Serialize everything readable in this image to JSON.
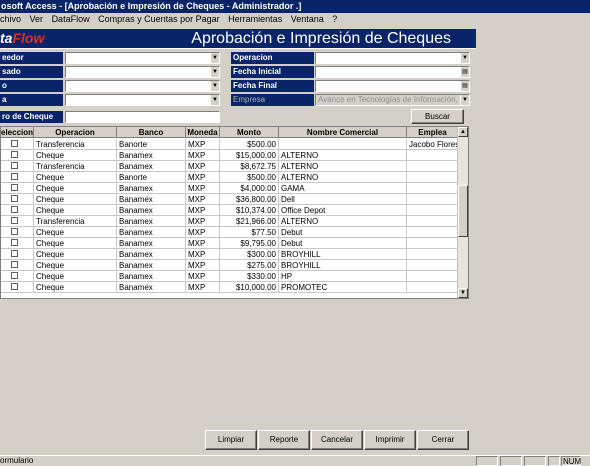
{
  "window": {
    "title": "osoft Access - [Aprobación e Impresión de Cheques - Administrador .]"
  },
  "menu": [
    "chivo",
    "Ver",
    "DataFlow",
    "Compras y Cuentas por Pagar",
    "Herramientas",
    "Ventana",
    "?"
  ],
  "banner": {
    "logo_prefix": "ta",
    "logo_suffix": "Flow",
    "title": "Aprobación e Impresión de Cheques"
  },
  "filters": {
    "left": [
      {
        "label": "eedor",
        "value": ""
      },
      {
        "label": "sado",
        "value": ""
      },
      {
        "label": "o",
        "value": ""
      },
      {
        "label": "a",
        "value": ""
      }
    ],
    "right": [
      {
        "label": "Operacion",
        "value": ""
      },
      {
        "label": "Fecha Inicial",
        "value": ""
      },
      {
        "label": "Fecha Final",
        "value": ""
      },
      {
        "label": "Empresa",
        "value": "Avance en Tecnologías de Información, SA de C"
      }
    ],
    "cheque_label": "ro de Cheque",
    "cheque_value": "",
    "search_label": "Buscar"
  },
  "grid": {
    "columns": [
      "eleccion",
      "Operacion",
      "Banco",
      "Moneda",
      "Monto",
      "Nombre Comercial",
      "Emplea"
    ],
    "rows": [
      {
        "op": "Transferencia",
        "bank": "Banorte",
        "cur": "MXP",
        "amount": "$500.00",
        "name": "",
        "emp": "Jacobo Flores"
      },
      {
        "op": "Cheque",
        "bank": "Banamex",
        "cur": "MXP",
        "amount": "$15,000.00",
        "name": "ALTERNO",
        "emp": ""
      },
      {
        "op": "Transferencia",
        "bank": "Banamex",
        "cur": "MXP",
        "amount": "$8,672.75",
        "name": "ALTERNO",
        "emp": ""
      },
      {
        "op": "Cheque",
        "bank": "Banorte",
        "cur": "MXP",
        "amount": "$500.00",
        "name": "ALTERNO",
        "emp": ""
      },
      {
        "op": "Cheque",
        "bank": "Banamex",
        "cur": "MXP",
        "amount": "$4,000.00",
        "name": "GAMA",
        "emp": ""
      },
      {
        "op": "Cheque",
        "bank": "Banamex",
        "cur": "MXP",
        "amount": "$36,800.00",
        "name": "Dell",
        "emp": ""
      },
      {
        "op": "Cheque",
        "bank": "Banamex",
        "cur": "MXP",
        "amount": "$10,374.00",
        "name": "Office Depot",
        "emp": ""
      },
      {
        "op": "Transferencia",
        "bank": "Banamex",
        "cur": "MXP",
        "amount": "$21,966.00",
        "name": "ALTERNO",
        "emp": ""
      },
      {
        "op": "Cheque",
        "bank": "Banamex",
        "cur": "MXP",
        "amount": "$77.50",
        "name": "Debut",
        "emp": ""
      },
      {
        "op": "Cheque",
        "bank": "Banamex",
        "cur": "MXP",
        "amount": "$9,795.00",
        "name": "Debut",
        "emp": ""
      },
      {
        "op": "Cheque",
        "bank": "Banamex",
        "cur": "MXP",
        "amount": "$300.00",
        "name": "BROYHILL",
        "emp": ""
      },
      {
        "op": "Cheque",
        "bank": "Banamex",
        "cur": "MXP",
        "amount": "$275.00",
        "name": "BROYHILL",
        "emp": ""
      },
      {
        "op": "Cheque",
        "bank": "Banamex",
        "cur": "MXP",
        "amount": "$330.00",
        "name": "HP",
        "emp": ""
      },
      {
        "op": "Cheque",
        "bank": "Banamex",
        "cur": "MXP",
        "amount": "$10,000.00",
        "name": "PROMOTEC",
        "emp": ""
      }
    ]
  },
  "actions": [
    "Limpiar",
    "Reporte",
    "Cancelar",
    "Imprimir",
    "Cerrar"
  ],
  "status": {
    "text": "ormulario",
    "mode": "NUM"
  }
}
